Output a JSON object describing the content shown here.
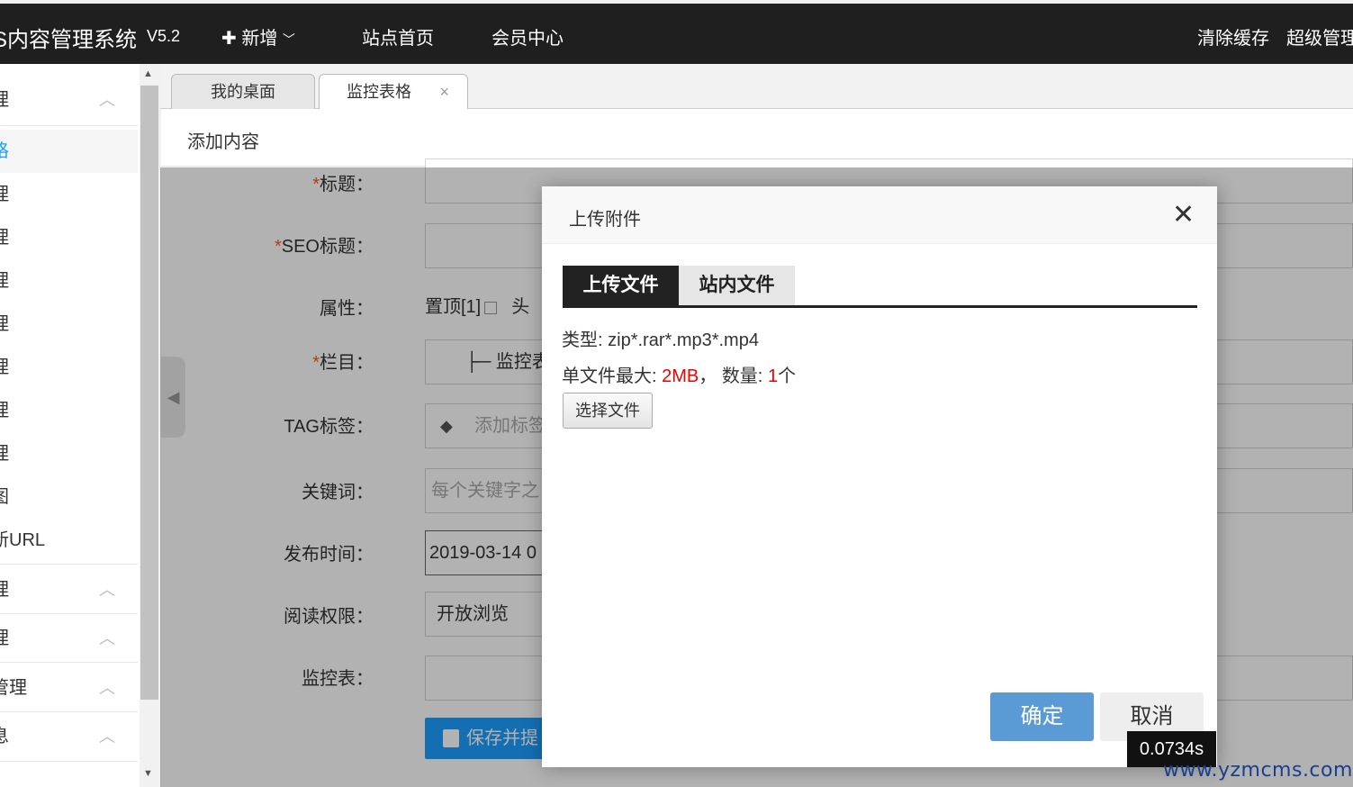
{
  "header": {
    "title": "S内容管理系统",
    "version": "V5.2",
    "nav": [
      {
        "icon": "plus-icon",
        "label": "新增",
        "dropdown": true
      },
      {
        "label": "站点首页"
      },
      {
        "label": "会员中心"
      }
    ],
    "right": [
      "清除缓存",
      "超级管理"
    ]
  },
  "sidebar": {
    "items": [
      {
        "label": "理",
        "expandable": true
      },
      {
        "label": "格",
        "active": true
      },
      {
        "label": "理"
      },
      {
        "label": "理"
      },
      {
        "label": "理"
      },
      {
        "label": "理"
      },
      {
        "label": "理"
      },
      {
        "label": "理"
      },
      {
        "label": "理"
      },
      {
        "label": "图"
      },
      {
        "label": "新URL"
      },
      {
        "label": "理",
        "expandable": true
      },
      {
        "label": "理",
        "expandable": true
      },
      {
        "label": "管理",
        "expandable": true
      },
      {
        "label": "息",
        "expandable": true
      }
    ]
  },
  "tabs": [
    {
      "label": "我的桌面"
    },
    {
      "label": "监控表格",
      "closable": true,
      "active": true
    }
  ],
  "page": {
    "heading": "添加内容"
  },
  "form": {
    "fields": [
      {
        "label": "标题：",
        "required": true,
        "value": ""
      },
      {
        "label": "SEO标题：",
        "required": true,
        "value": ""
      },
      {
        "label": "属性：",
        "option": "置顶[1]",
        "option2": "头"
      },
      {
        "label": "栏目：",
        "required": true,
        "value": "├─ 监控表"
      },
      {
        "label": "TAG标签：",
        "placeholder": "添加标签"
      },
      {
        "label": "关键词：",
        "placeholder": "每个关键字之"
      },
      {
        "label": "发布时间：",
        "value": "2019-03-14 0"
      },
      {
        "label": "阅读权限：",
        "value": "开放浏览"
      },
      {
        "label": "监控表：",
        "value": ""
      }
    ],
    "save_label": "保存并提"
  },
  "dialog": {
    "title": "上传附件",
    "tabs": [
      "上传文件",
      "站内文件"
    ],
    "type_label": "类型: ",
    "type_value": "zip*.rar*.mp3*.mp4",
    "max_label": "单文件最大: ",
    "max_value": "2MB",
    "sep": "， ",
    "count_label": "数量: ",
    "count_value": "1",
    "count_unit": "个",
    "pick_button": "选择文件",
    "ok": "确定",
    "cancel": "取消"
  },
  "timer": "0.0734s",
  "watermark": "www.yzmcms.com"
}
